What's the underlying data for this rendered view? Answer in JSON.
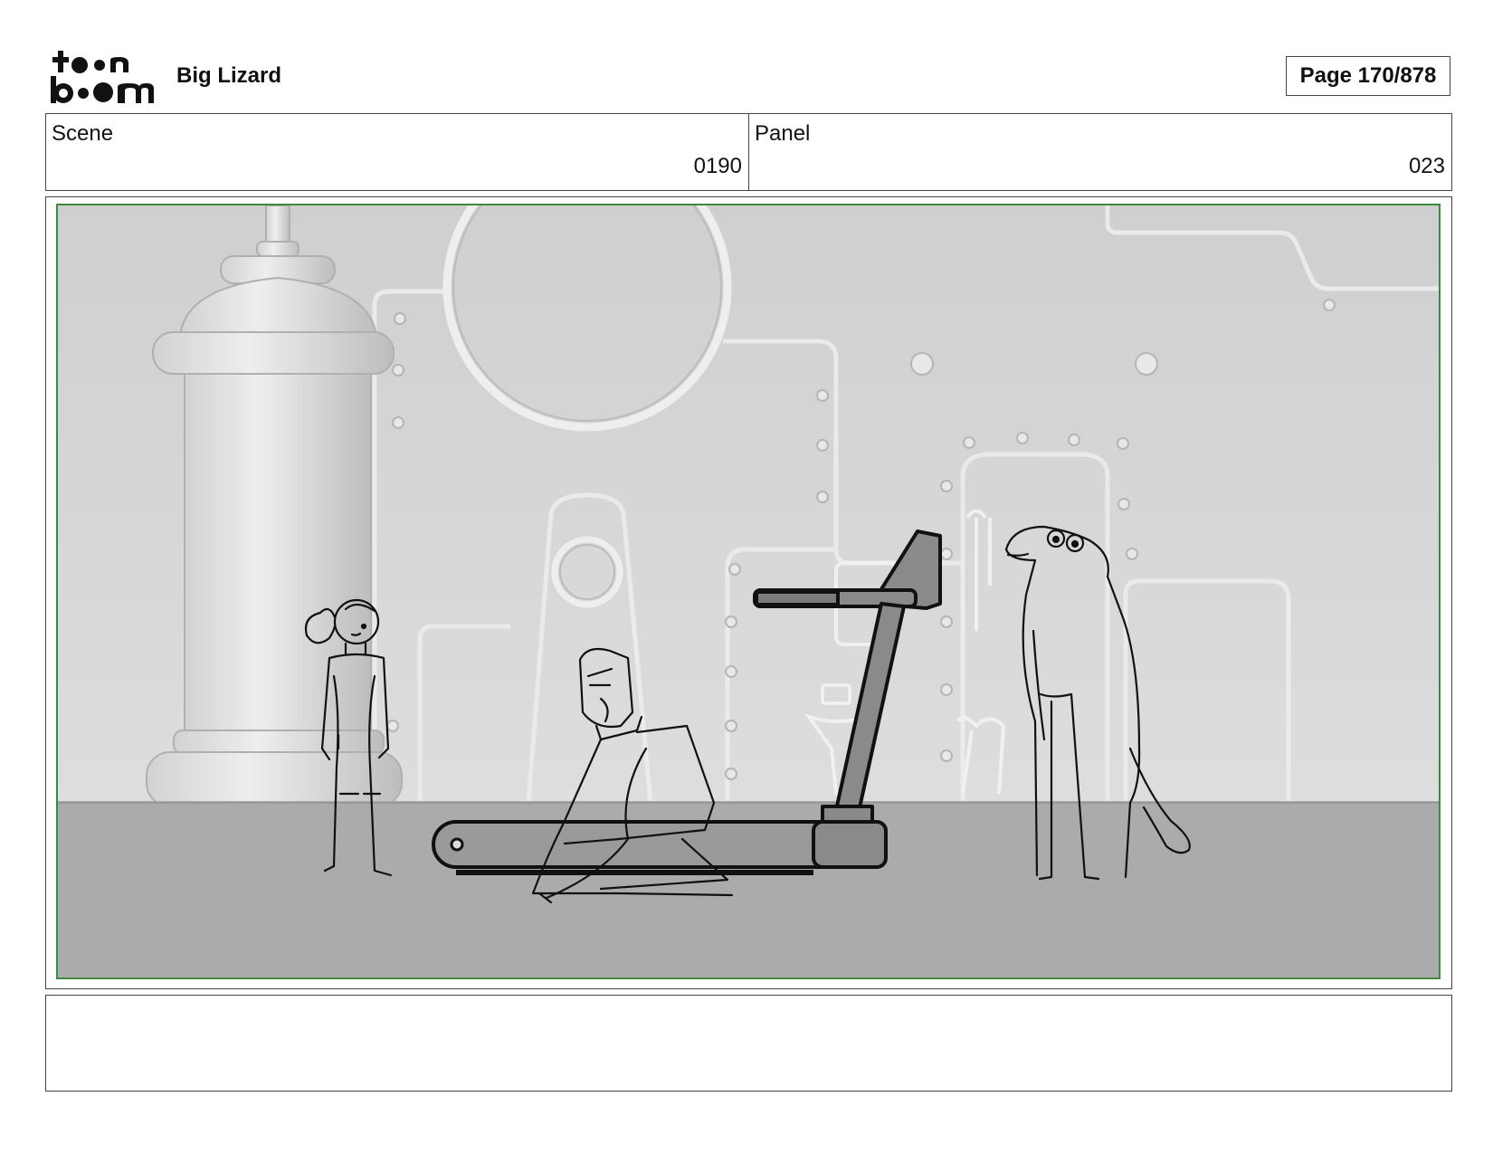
{
  "header": {
    "logo_text_top": "toon",
    "logo_text_bottom": "boom",
    "project_title": "Big Lizard",
    "page_indicator": "Page 170/878"
  },
  "info": {
    "scene_label": "Scene",
    "scene_value": "0190",
    "panel_label": "Panel",
    "panel_value": "023"
  },
  "notes": {
    "text": ""
  },
  "colors": {
    "frame_border": "#444444",
    "safe_area": "#3c8a3a",
    "wall": "#d9d9d9",
    "floor": "#ababab"
  }
}
